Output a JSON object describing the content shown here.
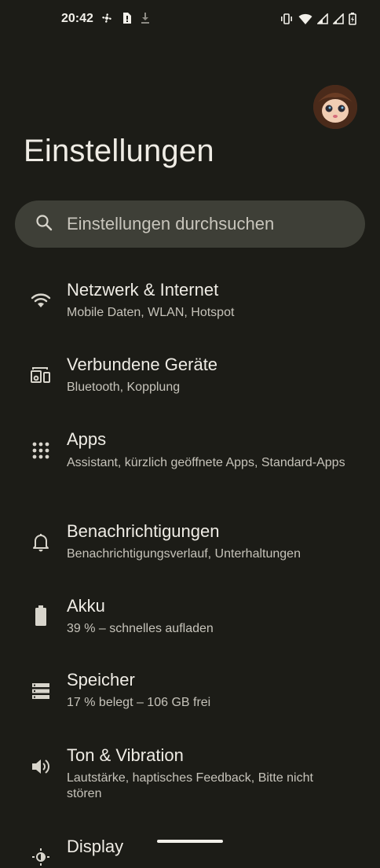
{
  "status_bar": {
    "time": "20:42"
  },
  "header": {
    "title": "Einstellungen"
  },
  "search": {
    "placeholder": "Einstellungen durchsuchen"
  },
  "settings": [
    {
      "title": "Netzwerk & Internet",
      "subtitle": "Mobile Daten, WLAN, Hotspot",
      "icon": "wifi-icon"
    },
    {
      "title": "Verbundene Geräte",
      "subtitle": "Bluetooth, Kopplung",
      "icon": "devices-icon"
    },
    {
      "title": "Apps",
      "subtitle": "Assistant, kürzlich geöffnete Apps, Standard-Apps",
      "icon": "apps-grid-icon"
    },
    {
      "title": "Benachrichtigungen",
      "subtitle": "Benachrichtigungsverlauf, Unterhaltungen",
      "icon": "bell-icon"
    },
    {
      "title": "Akku",
      "subtitle": "39 % – schnelles aufladen",
      "icon": "battery-icon"
    },
    {
      "title": "Speicher",
      "subtitle": "17 % belegt – 106 GB frei",
      "icon": "storage-icon"
    },
    {
      "title": "Ton & Vibration",
      "subtitle": "Lautstärke, haptisches Feedback, Bitte nicht stören",
      "icon": "volume-icon"
    },
    {
      "title": "Display",
      "subtitle": "",
      "icon": "display-icon"
    }
  ],
  "colors": {
    "background": "#1c1c17",
    "search_background": "#3e3f37",
    "text_primary": "#efece5",
    "text_secondary": "#c6c3ba"
  }
}
